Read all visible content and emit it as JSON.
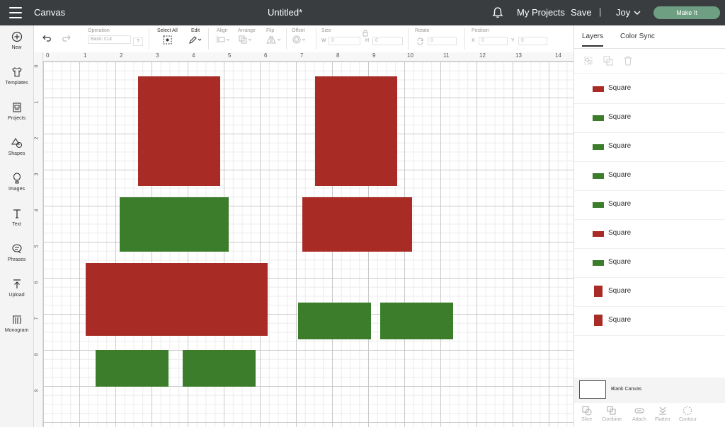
{
  "topbar": {
    "app_title": "Canvas",
    "doc_title": "Untitled*",
    "my_projects": "My Projects",
    "save": "Save",
    "separator": "|",
    "user": "Joy",
    "make_it": "Make It"
  },
  "rail": [
    {
      "label": "New",
      "icon": "plus-circle-icon"
    },
    {
      "label": "Templates",
      "icon": "shirt-icon"
    },
    {
      "label": "Projects",
      "icon": "projects-icon"
    },
    {
      "label": "Shapes",
      "icon": "shapes-icon"
    },
    {
      "label": "Images",
      "icon": "balloon-icon"
    },
    {
      "label": "Text",
      "icon": "text-icon"
    },
    {
      "label": "Phrases",
      "icon": "speech-icon"
    },
    {
      "label": "Upload",
      "icon": "upload-icon"
    },
    {
      "label": "Monogram",
      "icon": "monogram-icon"
    }
  ],
  "toolbar": {
    "operation_label": "Operation",
    "operation_value": "Basic Cut",
    "select_all": "Select All",
    "edit": "Edit",
    "align": "Align",
    "arrange": "Arrange",
    "flip": "Flip",
    "offset": "Offset",
    "size": "Size",
    "w": "W",
    "h": "H",
    "rotate": "Rotate",
    "position": "Position",
    "x": "X",
    "y": "Y",
    "zero": "0"
  },
  "ruler": {
    "top": [
      "0",
      "1",
      "2",
      "3",
      "4",
      "5",
      "6",
      "7",
      "8",
      "9",
      "10",
      "11",
      "12",
      "13",
      "14"
    ],
    "left": [
      "0",
      "1",
      "2",
      "3",
      "4",
      "5",
      "6",
      "7",
      "8",
      "9"
    ]
  },
  "colors": {
    "red": "#a82b26",
    "green": "#3c7d2c"
  },
  "panel": {
    "tab_layers": "Layers",
    "tab_color_sync": "Color Sync",
    "layers": [
      {
        "label": "Square",
        "color": "red",
        "shape": "wide"
      },
      {
        "label": "Square",
        "color": "green",
        "shape": "wide"
      },
      {
        "label": "Square",
        "color": "green",
        "shape": "wide"
      },
      {
        "label": "Square",
        "color": "green",
        "shape": "wide"
      },
      {
        "label": "Square",
        "color": "green",
        "shape": "wide"
      },
      {
        "label": "Square",
        "color": "red",
        "shape": "wide"
      },
      {
        "label": "Square",
        "color": "green",
        "shape": "wide"
      },
      {
        "label": "Square",
        "color": "red",
        "shape": "tall"
      },
      {
        "label": "Square",
        "color": "red",
        "shape": "tall"
      }
    ],
    "blank_canvas": "Blank Canvas",
    "bottom_tools": [
      "Slice",
      "Combine",
      "Attach",
      "Flatten",
      "Contour"
    ]
  }
}
